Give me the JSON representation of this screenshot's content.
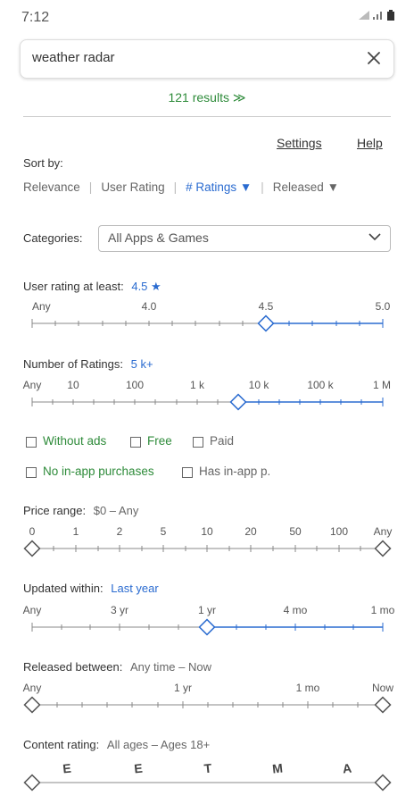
{
  "status_bar": {
    "time": "7:12"
  },
  "search": {
    "value": "weather radar"
  },
  "results": {
    "text": "121  results  ≫"
  },
  "links": {
    "settings": "Settings",
    "help": "Help"
  },
  "sort": {
    "label": "Sort by:",
    "options": [
      "Relevance",
      "User Rating",
      "# Ratings ▼",
      "Released ▼"
    ]
  },
  "categories": {
    "label": "Categories:",
    "selected": "All Apps & Games"
  },
  "user_rating": {
    "label": "User rating at least:",
    "value": "4.5 ★",
    "ticks": [
      "Any",
      "4.0",
      "4.5",
      "5.0"
    ]
  },
  "num_ratings": {
    "label": "Number of Ratings:",
    "value": "5 k+",
    "ticks": [
      "Any",
      "10",
      "100",
      "1 k",
      "10 k",
      "100 k",
      "1 M"
    ]
  },
  "filters": {
    "without_ads": "Without ads",
    "free": "Free",
    "paid": "Paid",
    "no_iap": "No in-app purchases",
    "has_iap": "Has in-app p."
  },
  "price": {
    "label": "Price range:",
    "value": "$0  –  Any",
    "ticks": [
      "0",
      "1",
      "2",
      "5",
      "10",
      "20",
      "50",
      "100",
      "Any"
    ]
  },
  "updated": {
    "label": "Updated within:",
    "value": "Last year",
    "ticks": [
      "Any",
      "3 yr",
      "1 yr",
      "4 mo",
      "1 mo"
    ]
  },
  "released": {
    "label": "Released between:",
    "value": "Any time  –  Now",
    "ticks": [
      "Any",
      "1 yr",
      "1 mo",
      "Now"
    ]
  },
  "content": {
    "label": "Content rating:",
    "value": "All ages  –  Ages 18+",
    "ticks": [
      "E",
      "E",
      "T",
      "M",
      "A"
    ]
  },
  "colors": {
    "accent_blue": "#2a6bd0",
    "accent_green": "#2e8b3a"
  }
}
